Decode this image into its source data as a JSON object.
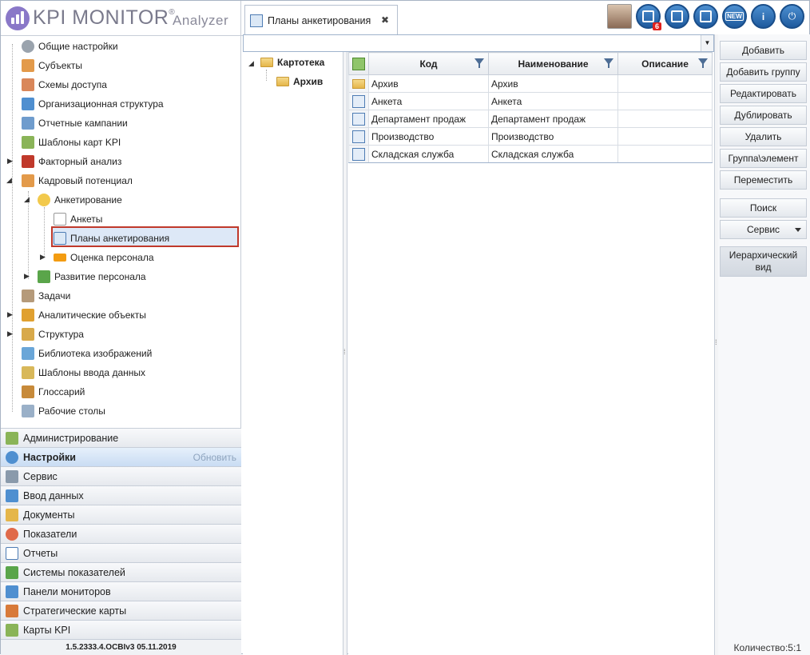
{
  "app": {
    "logo_text": "KPI MONITOR",
    "registered": "®",
    "subtitle": "Analyzer",
    "version": "1.5.2333.4.OCBIv3  05.11.2019"
  },
  "tab": {
    "title": "Планы анкетирования",
    "close": "✖"
  },
  "toolbar": {
    "notifications_badge": "6",
    "new_label": "NEW",
    "info_label": "i"
  },
  "nav_tree": [
    {
      "label": "Общие настройки",
      "icon": "gear-icon"
    },
    {
      "label": "Субъекты",
      "icon": "users-icon"
    },
    {
      "label": "Схемы доступа",
      "icon": "users-lock-icon"
    },
    {
      "label": "Организационная структура",
      "icon": "org-chart-icon"
    },
    {
      "label": "Отчетные кампании",
      "icon": "notebook-icon"
    },
    {
      "label": "Шаблоны карт KPI",
      "icon": "template-icon"
    },
    {
      "label": "Факторный анализ",
      "icon": "beta-icon"
    },
    {
      "label": "Кадровый потенциал",
      "icon": "people-icon"
    },
    {
      "label": "Анкетирование",
      "icon": "star-icon"
    },
    {
      "label": "Анкеты",
      "icon": "form-icon"
    },
    {
      "label": "Планы анкетирования",
      "icon": "plan-icon"
    },
    {
      "label": "Оценка персонала",
      "icon": "new-badge-icon"
    },
    {
      "label": "Развитие персонала",
      "icon": "growth-icon"
    },
    {
      "label": "Задачи",
      "icon": "tasks-icon"
    },
    {
      "label": "Аналитические объекты",
      "icon": "analytics-icon"
    },
    {
      "label": "Структура",
      "icon": "structure-icon"
    },
    {
      "label": "Библиотека изображений",
      "icon": "image-library-icon"
    },
    {
      "label": "Шаблоны ввода данных",
      "icon": "data-template-icon"
    },
    {
      "label": "Глоссарий",
      "icon": "book-icon"
    },
    {
      "label": "Рабочие столы",
      "icon": "desktop-icon"
    }
  ],
  "accordion": [
    {
      "label": "Администрирование",
      "icon": "admin-icon"
    },
    {
      "label": "Настройки",
      "icon": "settings-icon",
      "action": "Обновить"
    },
    {
      "label": "Сервис",
      "icon": "tools-icon"
    },
    {
      "label": "Ввод данных",
      "icon": "data-entry-icon"
    },
    {
      "label": "Документы",
      "icon": "documents-icon"
    },
    {
      "label": "Показатели",
      "icon": "indicators-icon"
    },
    {
      "label": "Отчеты",
      "icon": "reports-icon"
    },
    {
      "label": "Системы показателей",
      "icon": "systems-icon"
    },
    {
      "label": "Панели мониторов",
      "icon": "dashboard-icon"
    },
    {
      "label": "Стратегические карты",
      "icon": "strategy-icon"
    },
    {
      "label": "Карты KPI",
      "icon": "kpi-cards-icon"
    }
  ],
  "search": {
    "value": "",
    "placeholder": ""
  },
  "folder_tree": {
    "root": "Картотека",
    "child": "Архив"
  },
  "grid": {
    "columns": [
      "Код",
      "Наименование",
      "Описание"
    ],
    "rows": [
      {
        "type": "folder",
        "code": "Архив",
        "name": "Архив",
        "desc": ""
      },
      {
        "type": "item",
        "code": "Анкета",
        "name": "Анкета",
        "desc": ""
      },
      {
        "type": "item",
        "code": "Департамент продаж",
        "name": "Департамент продаж",
        "desc": ""
      },
      {
        "type": "item",
        "code": "Производство",
        "name": "Производство",
        "desc": ""
      },
      {
        "type": "item",
        "code": "Складская служба",
        "name": "Складская служба",
        "desc": ""
      }
    ]
  },
  "actions": {
    "add": "Добавить",
    "add_group": "Добавить группу",
    "edit": "Редактировать",
    "duplicate": "Дублировать",
    "delete": "Удалить",
    "group_element": "Группа\\элемент",
    "move": "Переместить",
    "search": "Поиск",
    "service": "Сервис",
    "hier_line1": "Иерархический",
    "hier_line2": "вид"
  },
  "status": {
    "count": "Количество:5:1"
  },
  "colors": {
    "accent": "#4c8fd0",
    "highlight_border": "#c0392b",
    "logo": "#8a78c8"
  }
}
